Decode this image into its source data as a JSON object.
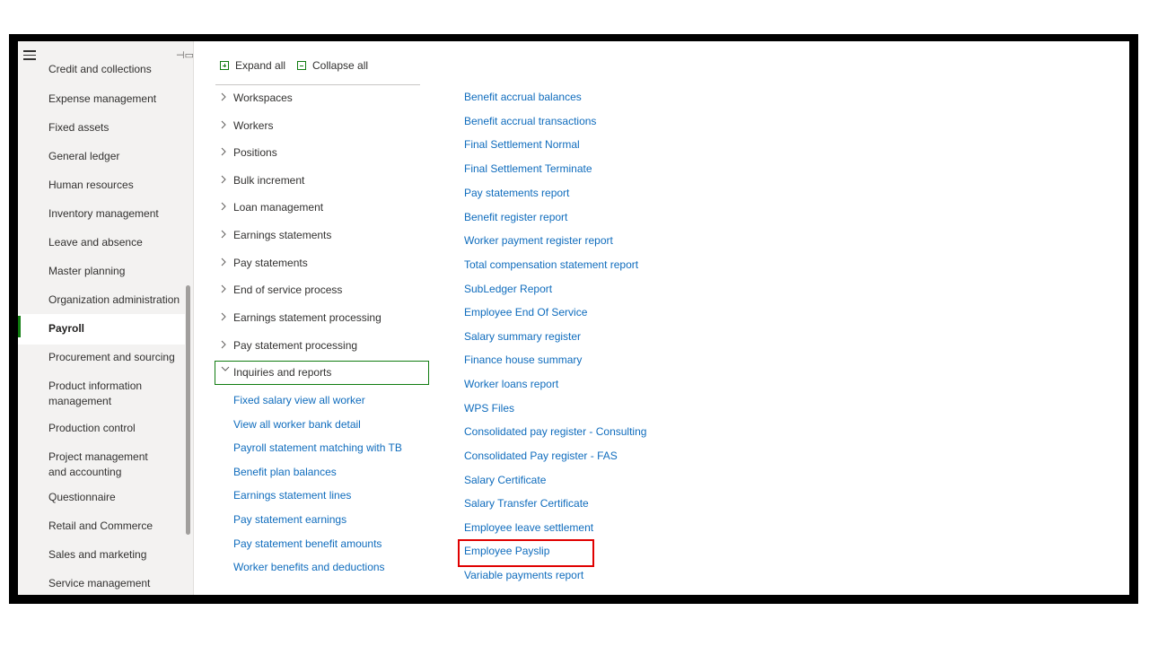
{
  "sidebar": {
    "items": [
      {
        "label": "Credit and collections"
      },
      {
        "label": "Expense management"
      },
      {
        "label": "Fixed assets"
      },
      {
        "label": "General ledger"
      },
      {
        "label": "Human resources"
      },
      {
        "label": "Inventory management"
      },
      {
        "label": "Leave and absence"
      },
      {
        "label": "Master planning"
      },
      {
        "label": "Organization administration"
      },
      {
        "label": "Payroll"
      },
      {
        "label": "Procurement and sourcing"
      },
      {
        "label": "Product information management"
      },
      {
        "label": "Production control"
      },
      {
        "label": "Project management and accounting"
      },
      {
        "label": "Questionnaire"
      },
      {
        "label": "Retail and Commerce"
      },
      {
        "label": "Sales and marketing"
      },
      {
        "label": "Service management"
      }
    ],
    "active": "Payroll",
    "accent_color": "#107c10"
  },
  "toolbar": {
    "expand_all": "Expand all",
    "collapse_all": "Collapse all"
  },
  "tree": {
    "groups": [
      {
        "label": "Workspaces"
      },
      {
        "label": "Workers"
      },
      {
        "label": "Positions"
      },
      {
        "label": "Bulk increment"
      },
      {
        "label": "Loan management"
      },
      {
        "label": "Earnings statements"
      },
      {
        "label": "Pay statements"
      },
      {
        "label": "End of service process"
      },
      {
        "label": "Earnings statement processing"
      },
      {
        "label": "Pay statement processing"
      },
      {
        "label": "Inquiries and reports"
      }
    ],
    "expanded": "Inquiries and reports",
    "sub_links": [
      {
        "label": "Fixed salary view all worker"
      },
      {
        "label": "View all worker bank detail"
      },
      {
        "label": "Payroll statement matching with TB"
      },
      {
        "label": "Benefit plan balances"
      },
      {
        "label": "Earnings statement lines"
      },
      {
        "label": "Pay statement earnings"
      },
      {
        "label": "Pay statement benefit amounts"
      },
      {
        "label": "Worker benefits and deductions"
      }
    ]
  },
  "reports": {
    "links": [
      {
        "label": "Benefit accrual balances"
      },
      {
        "label": "Benefit accrual transactions"
      },
      {
        "label": "Final Settlement Normal"
      },
      {
        "label": "Final Settlement Terminate"
      },
      {
        "label": "Pay statements report"
      },
      {
        "label": "Benefit register report"
      },
      {
        "label": "Worker payment register report"
      },
      {
        "label": "Total compensation statement report"
      },
      {
        "label": "SubLedger Report"
      },
      {
        "label": "Employee End Of Service"
      },
      {
        "label": "Salary summary register"
      },
      {
        "label": "Finance house summary"
      },
      {
        "label": "Worker loans report"
      },
      {
        "label": "WPS Files"
      },
      {
        "label": "Consolidated pay register - Consulting"
      },
      {
        "label": "Consolidated Pay register - FAS"
      },
      {
        "label": "Salary Certificate"
      },
      {
        "label": "Salary Transfer Certificate"
      },
      {
        "label": "Employee leave settlement"
      },
      {
        "label": "Employee Payslip"
      },
      {
        "label": "Variable payments report"
      }
    ],
    "highlighted": "Employee Payslip",
    "highlight_color": "#e00000",
    "link_color": "#0f6cbd"
  }
}
